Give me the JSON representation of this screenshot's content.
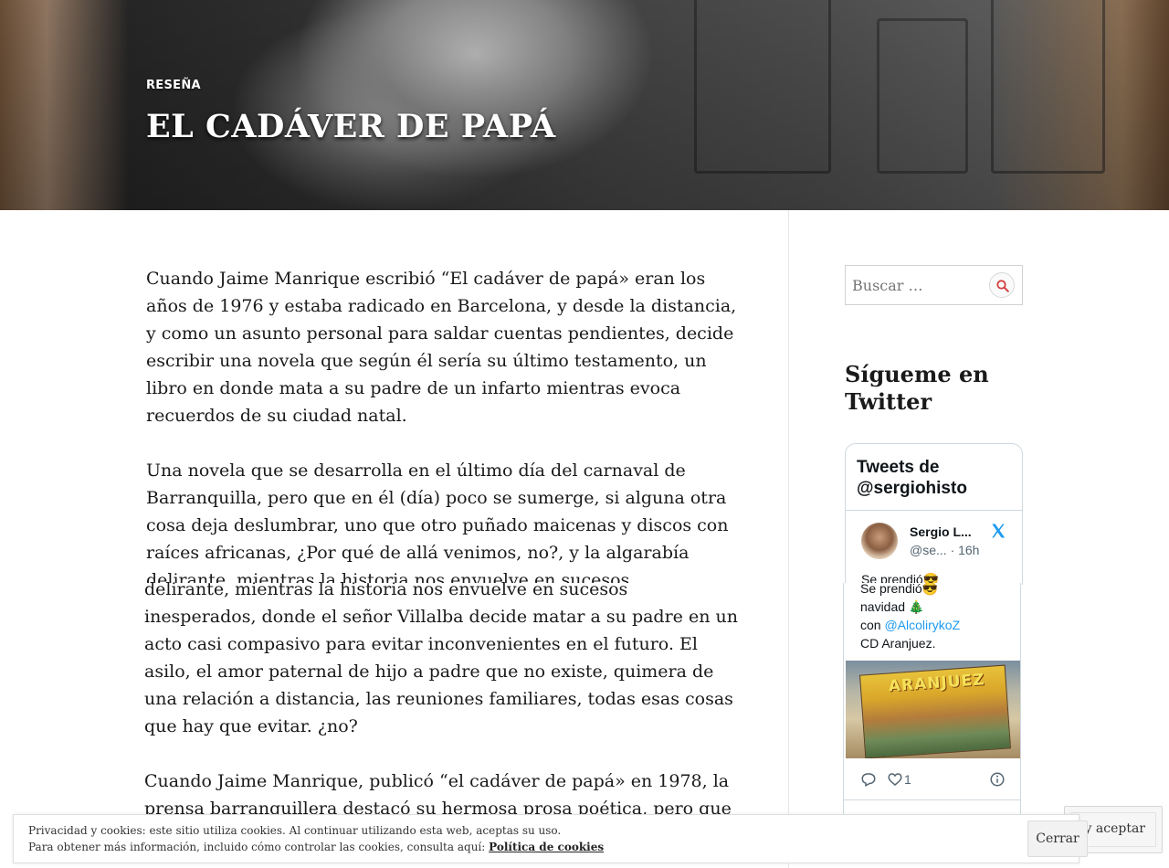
{
  "hero": {
    "category": "RESEÑA",
    "title": "EL CADÁVER DE PAPÁ"
  },
  "article": {
    "paragraphs_top": [
      "Cuando Jaime Manrique escribió “El cadáver de papá» eran los años de 1976 y estaba radicado en Barcelona, y desde la distancia, y como un asunto personal para saldar cuentas pendientes, decide escribir una novela que según él sería su último testamento, un libro en donde mata a su padre de un infarto mientras evoca recuerdos de su ciudad natal.",
      "Una novela que se desarrolla en el último día del carnaval de Barranquilla, pero que en él (día) poco se sumerge, si alguna otra cosa deja deslumbrar, uno que otro puñado maicenas y discos con raíces africanas,  ¿Por qué de allá venimos, no?, y la algarabía delirante, mientras la historia nos envuelve en sucesos inesperados,"
    ],
    "paragraphs_bottom": [
      "delirante, mientras la historia nos envuelve en sucesos inesperados, donde el señor Villalba decide matar a su padre en un acto casi compasivo para evitar inconvenientes en el futuro. El asilo, el amor paternal de hijo a padre que no existe, quimera de una relación a distancia, las reuniones familiares, todas esas cosas que hay que evitar. ¿no?",
      "Cuando Jaime Manrique, publicó “el cadáver de papá» en 1978, la prensa barranquillera destacó su hermosa prosa poética, pero que no? Entonces esta hermosa novela pasa a hacer una gran novela, y"
    ]
  },
  "sidebar": {
    "search_placeholder": "Buscar …",
    "twitter_widget_title": "Sígueme en Twitter",
    "twitter": {
      "header": "Tweets de @sergiohisto",
      "tweet": {
        "name": "Sergio L...",
        "handle": "@se...",
        "time": "· 16h",
        "line1": "Se prendió😎",
        "line2": " navidad 🎄",
        "line3_prefix": "con ",
        "mention": "@AlcolirykoZ",
        "line4": "CD Aranjuez.",
        "media_text": "ARANJUEZ",
        "likes": "1"
      }
    }
  },
  "cookies": {
    "line1": "Privacidad y cookies: este sitio utiliza cookies. Al continuar utilizando esta web, aceptas su uso.",
    "line2_prefix": "Para obtener más información, incluido cómo controlar las cookies, consulta aquí: ",
    "policy_link": "Política de cookies",
    "close_label": "Cerrar",
    "accept_label": "Cerrar y aceptar"
  },
  "colors": {
    "twitter_blue": "#1d9bf0",
    "search_icon": "#d33c3c"
  }
}
